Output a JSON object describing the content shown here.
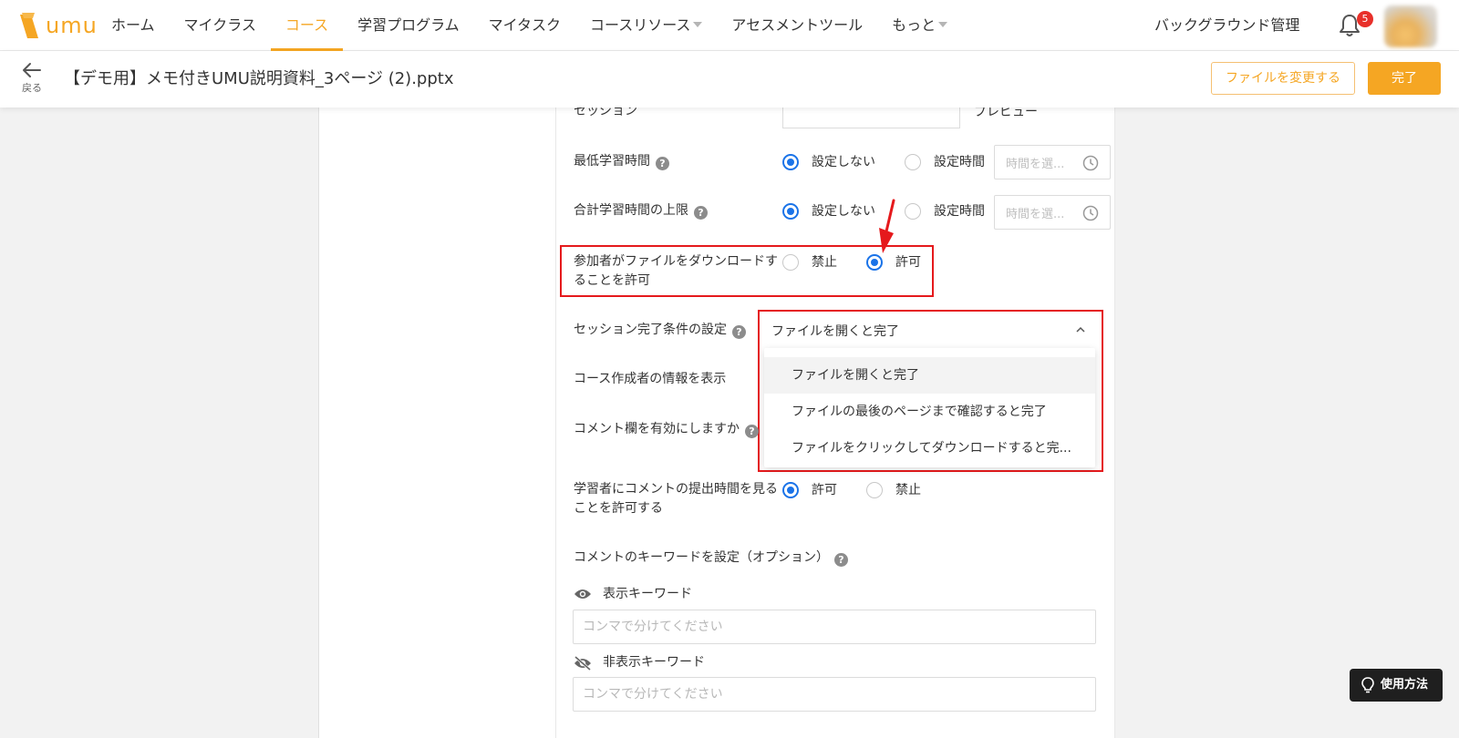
{
  "nav": {
    "logo_text": "umu",
    "items": [
      {
        "label": "ホーム"
      },
      {
        "label": "マイクラス"
      },
      {
        "label": "コース"
      },
      {
        "label": "学習プログラム"
      },
      {
        "label": "マイタスク"
      },
      {
        "label": "コースリソース"
      },
      {
        "label": "アセスメントツール"
      },
      {
        "label": "もっと"
      }
    ],
    "active_item": "コース",
    "background_admin": "バックグラウンド管理",
    "notification_count": "5",
    "accent_color": "#f5a623",
    "badge_color": "#e8302a"
  },
  "subheader": {
    "back_label": "戻る",
    "title": "【デモ用】メモ付きUMU説明資料_3ページ (2).pptx",
    "change_file_label": "ファイルを変更する",
    "done_label": "完了"
  },
  "form": {
    "session_label": "セッション",
    "preview_label": "プレビュー",
    "min_study_time": {
      "label": "最低学習時間",
      "opt_none": "設定しない",
      "opt_set": "設定時間",
      "selected": "設定しない",
      "time_placeholder": "時間を選..."
    },
    "max_study_time": {
      "label": "合計学習時間の上限",
      "opt_none": "設定しない",
      "opt_set": "設定時間",
      "selected": "設定しない",
      "time_placeholder": "時間を選..."
    },
    "download": {
      "label_line1": "参加者がファイルをダウンロードす",
      "label_line2": "ることを許可",
      "opt_forbid": "禁止",
      "opt_allow": "許可",
      "selected": "許可"
    },
    "completion": {
      "label": "セッション完了条件の設定",
      "value": "ファイルを開くと完了",
      "options": [
        "ファイルを開くと完了",
        "ファイルの最後のページまで確認すると完了",
        "ファイルをクリックしてダウンロードすると完..."
      ]
    },
    "creator_info_label": "コース作成者の情報を表示",
    "comments_label": "コメント欄を有効にしますか",
    "comment_time": {
      "label_line1": "学習者にコメントの提出時間を見る",
      "label_line2": "ことを許可する",
      "opt_allow": "許可",
      "opt_forbid": "禁止",
      "selected": "許可"
    },
    "keywords": {
      "label": "コメントのキーワードを設定（オプション）",
      "visible_label": "表示キーワード",
      "visible_placeholder": "コンマで分けてください",
      "hidden_label": "非表示キーワード",
      "hidden_placeholder": "コンマで分けてください"
    }
  },
  "help": {
    "label": "使用方法"
  },
  "annotation_color": "#e5191c",
  "radio_color": "#1a73e8"
}
